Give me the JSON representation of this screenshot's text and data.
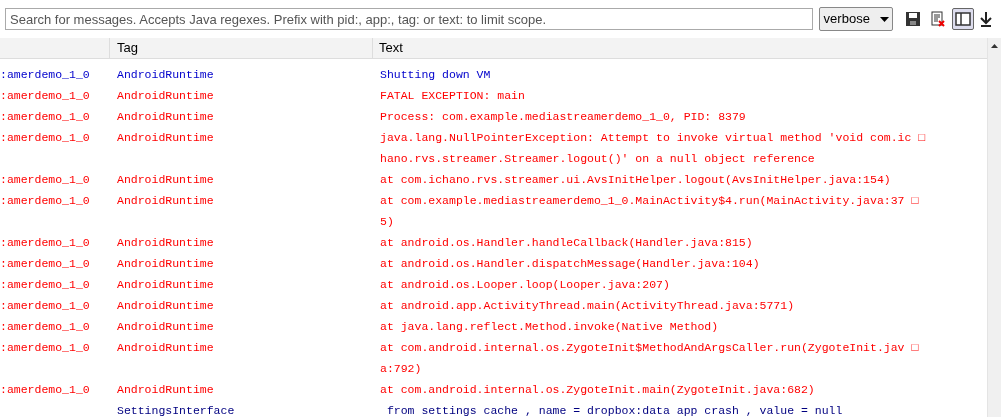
{
  "search": {
    "placeholder": "Search for messages. Accepts Java regexes. Prefix with pid:, app:, tag: or text: to limit scope."
  },
  "log_level": "verbose",
  "toolbar": [
    {
      "kind": "save",
      "pressed": false
    },
    {
      "kind": "clear",
      "pressed": false
    },
    {
      "kind": "toggle-panel",
      "pressed": true
    },
    {
      "kind": "scroll-lock",
      "pressed": false
    }
  ],
  "table": {
    "columns": [
      "Tag",
      "Text"
    ],
    "rows": [
      {
        "color": "#0000cc",
        "app": ":amerdemo_1_0",
        "tag": "AndroidRuntime",
        "text": [
          "Shutting down VM"
        ]
      },
      {
        "color": "#ff0000",
        "app": ":amerdemo_1_0",
        "tag": "AndroidRuntime",
        "text": [
          "FATAL EXCEPTION: main"
        ]
      },
      {
        "color": "#ff0000",
        "app": ":amerdemo_1_0",
        "tag": "AndroidRuntime",
        "text": [
          "Process: com.example.mediastreamerdemo_1_0, PID: 8379"
        ]
      },
      {
        "color": "#ff0000",
        "app": ":amerdemo_1_0",
        "tag": "AndroidRuntime",
        "text": [
          "java.lang.NullPointerException: Attempt to invoke virtual method 'void com.ic □",
          "hano.rvs.streamer.Streamer.logout()' on a null object reference"
        ]
      },
      {
        "color": "#ff0000",
        "app": ":amerdemo_1_0",
        "tag": "AndroidRuntime",
        "text": [
          "at com.ichano.rvs.streamer.ui.AvsInitHelper.logout(AvsInitHelper.java:154)"
        ]
      },
      {
        "color": "#ff0000",
        "app": ":amerdemo_1_0",
        "tag": "AndroidRuntime",
        "text": [
          "at com.example.mediastreamerdemo_1_0.MainActivity$4.run(MainActivity.java:37 □",
          "5)"
        ]
      },
      {
        "color": "#ff0000",
        "app": ":amerdemo_1_0",
        "tag": "AndroidRuntime",
        "text": [
          "at android.os.Handler.handleCallback(Handler.java:815)"
        ]
      },
      {
        "color": "#ff0000",
        "app": ":amerdemo_1_0",
        "tag": "AndroidRuntime",
        "text": [
          "at android.os.Handler.dispatchMessage(Handler.java:104)"
        ]
      },
      {
        "color": "#ff0000",
        "app": ":amerdemo_1_0",
        "tag": "AndroidRuntime",
        "text": [
          "at android.os.Looper.loop(Looper.java:207)"
        ]
      },
      {
        "color": "#ff0000",
        "app": ":amerdemo_1_0",
        "tag": "AndroidRuntime",
        "text": [
          "at android.app.ActivityThread.main(ActivityThread.java:5771)"
        ]
      },
      {
        "color": "#ff0000",
        "app": ":amerdemo_1_0",
        "tag": "AndroidRuntime",
        "text": [
          "at java.lang.reflect.Method.invoke(Native Method)"
        ]
      },
      {
        "color": "#ff0000",
        "app": ":amerdemo_1_0",
        "tag": "AndroidRuntime",
        "text": [
          "at com.android.internal.os.ZygoteInit$MethodAndArgsCaller.run(ZygoteInit.jav □",
          "a:792)"
        ]
      },
      {
        "color": "#ff0000",
        "app": ":amerdemo_1_0",
        "tag": "AndroidRuntime",
        "text": [
          "at com.android.internal.os.ZygoteInit.main(ZygoteInit.java:682)"
        ]
      },
      {
        "color": "#000080",
        "tag": "SettingsInterface",
        "text": [
          " from settings cache , name = dropbox:data app crash , value = null"
        ]
      }
    ]
  }
}
